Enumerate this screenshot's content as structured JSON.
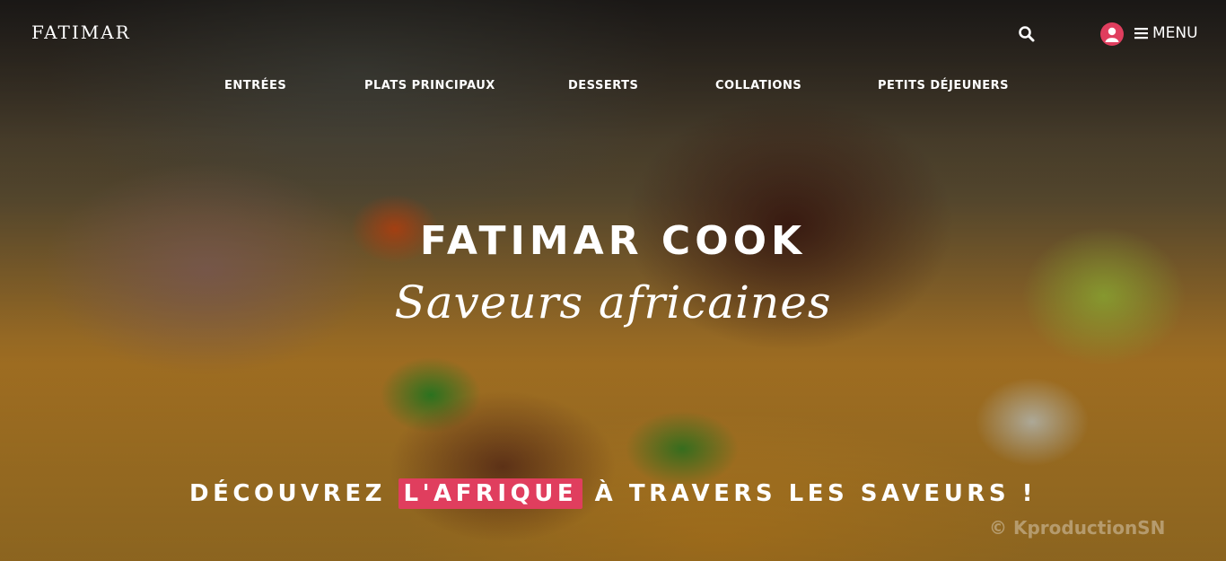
{
  "header": {
    "brand": "FATIMAR",
    "menu_label": "MENU",
    "icons": {
      "search": "search-icon",
      "user": "user-icon",
      "menu": "hamburger-icon"
    },
    "accent_color": "#e03e5e"
  },
  "nav": {
    "items": [
      {
        "label": "ENTRÉES"
      },
      {
        "label": "PLATS PRINCIPAUX"
      },
      {
        "label": "DESSERTS"
      },
      {
        "label": "COLLATIONS"
      },
      {
        "label": "PETITS DÉJEUNERS"
      }
    ]
  },
  "hero": {
    "title": "FATIMAR COOK",
    "subtitle": "Saveurs africaines",
    "tagline": {
      "before": "DÉCOUVREZ",
      "highlight": "L'AFRIQUE",
      "after": "À TRAVERS LES SAVEURS !"
    },
    "watermark": "© KproductionSN"
  }
}
